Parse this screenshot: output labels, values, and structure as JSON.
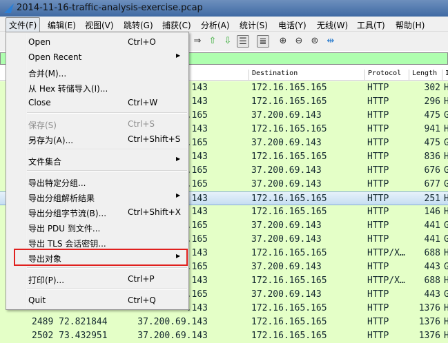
{
  "title": "2014-11-16-traffic-analysis-exercise.pcap",
  "menubar": [
    "文件(F)",
    "编辑(E)",
    "视图(V)",
    "跳转(G)",
    "捕获(C)",
    "分析(A)",
    "统计(S)",
    "电话(Y)",
    "无线(W)",
    "工具(T)",
    "帮助(H)"
  ],
  "columns": {
    "destination": "Destination",
    "protocol": "Protocol",
    "length": "Length",
    "info": "I"
  },
  "rows": [
    {
      "src": "143",
      "dst": "172.16.165.165",
      "proto": "HTTP",
      "len": "302",
      "info": "H"
    },
    {
      "src": "143",
      "dst": "172.16.165.165",
      "proto": "HTTP",
      "len": "296",
      "info": "H"
    },
    {
      "src": ".165",
      "dst": "37.200.69.143",
      "proto": "HTTP",
      "len": "475",
      "info": "G"
    },
    {
      "src": "143",
      "dst": "172.16.165.165",
      "proto": "HTTP",
      "len": "941",
      "info": "H"
    },
    {
      "src": ".165",
      "dst": "37.200.69.143",
      "proto": "HTTP",
      "len": "475",
      "info": "G"
    },
    {
      "src": "143",
      "dst": "172.16.165.165",
      "proto": "HTTP",
      "len": "836",
      "info": "H"
    },
    {
      "src": ".165",
      "dst": "37.200.69.143",
      "proto": "HTTP",
      "len": "676",
      "info": "G"
    },
    {
      "src": ".165",
      "dst": "37.200.69.143",
      "proto": "HTTP",
      "len": "677",
      "info": "G"
    },
    {
      "src": "143",
      "dst": "172.16.165.165",
      "proto": "HTTP",
      "len": "251",
      "info": "H",
      "selected": true
    },
    {
      "src": "143",
      "dst": "172.16.165.165",
      "proto": "HTTP",
      "len": "146",
      "info": "H"
    },
    {
      "src": ".165",
      "dst": "37.200.69.143",
      "proto": "HTTP",
      "len": "441",
      "info": "G"
    },
    {
      "src": ".165",
      "dst": "37.200.69.143",
      "proto": "HTTP",
      "len": "441",
      "info": "G"
    },
    {
      "src": "143",
      "dst": "172.16.165.165",
      "proto": "HTTP/X…",
      "len": "688",
      "info": "H"
    },
    {
      "src": ".165",
      "dst": "37.200.69.143",
      "proto": "HTTP",
      "len": "443",
      "info": "G"
    },
    {
      "src": "143",
      "dst": "172.16.165.165",
      "proto": "HTTP/X…",
      "len": "688",
      "info": "H"
    },
    {
      "src": ".165",
      "dst": "37.200.69.143",
      "proto": "HTTP",
      "len": "443",
      "info": "G"
    },
    {
      "src": ".143",
      "dst": "172.16.165.165",
      "proto": "HTTP",
      "len": "1376",
      "info": "H"
    },
    {
      "no": "2489 72.821844",
      "src": "37.200.69.143",
      "dst": "172.16.165.165",
      "proto": "HTTP",
      "len": "1376",
      "info": "H"
    },
    {
      "no": "2502 73.432951",
      "src": "37.200.69.143",
      "dst": "172.16.165.165",
      "proto": "HTTP",
      "len": "1376",
      "info": "H"
    }
  ],
  "file_menu": [
    {
      "label": "Open",
      "shortcut": "Ctrl+O"
    },
    {
      "label": "Open Recent",
      "submenu": true
    },
    {
      "label": "合并(M)..."
    },
    {
      "label": "从 Hex 转储导入(I)..."
    },
    {
      "label": "Close",
      "shortcut": "Ctrl+W"
    },
    {
      "sep": true
    },
    {
      "label": "保存(S)",
      "shortcut": "Ctrl+S",
      "disabled": true
    },
    {
      "label": "另存为(A)...",
      "shortcut": "Ctrl+Shift+S"
    },
    {
      "sep": true
    },
    {
      "label": "文件集合",
      "submenu": true
    },
    {
      "sep": true
    },
    {
      "label": "导出特定分组..."
    },
    {
      "label": "导出分组解析结果",
      "submenu": true
    },
    {
      "label": "导出分组字节流(B)...",
      "shortcut": "Ctrl+Shift+X"
    },
    {
      "label": "导出 PDU 到文件..."
    },
    {
      "label": "导出 TLS 会话密钥..."
    },
    {
      "label": "导出对象",
      "submenu": true,
      "highlighted": true
    },
    {
      "sep": true
    },
    {
      "label": "打印(P)...",
      "shortcut": "Ctrl+P"
    },
    {
      "sep": true
    },
    {
      "label": "Quit",
      "shortcut": "Ctrl+Q"
    }
  ],
  "colors": {
    "row_bg": "#e4ffc7",
    "filter_bg": "#afffaf",
    "highlight_box": "#e0201e"
  }
}
